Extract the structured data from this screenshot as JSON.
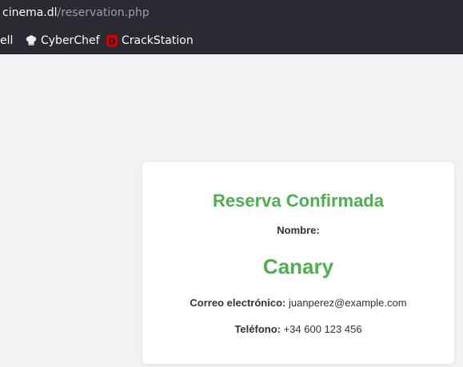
{
  "browser": {
    "url_host": "cinema.dl",
    "url_path": "/reservation.php",
    "bookmarks": [
      {
        "label": "ell",
        "icon": "none"
      },
      {
        "label": "CyberChef",
        "icon": "chef-hat-icon"
      },
      {
        "label": "CrackStation",
        "icon": "crackstation-icon",
        "icon_letter": "D"
      }
    ]
  },
  "reservation": {
    "title": "Reserva Confirmada",
    "name_label": "Nombre:",
    "name_value": "Canary",
    "email_label": "Correo electrónico:",
    "email_value": "juanperez@example.com",
    "phone_label": "Teléfono:",
    "phone_value": "+34 600 123 456"
  },
  "colors": {
    "accent_green": "#4caf50",
    "browser_chrome": "#2b2a33",
    "page_background": "#f2f2f2",
    "crackstation_red": "#d70000"
  }
}
